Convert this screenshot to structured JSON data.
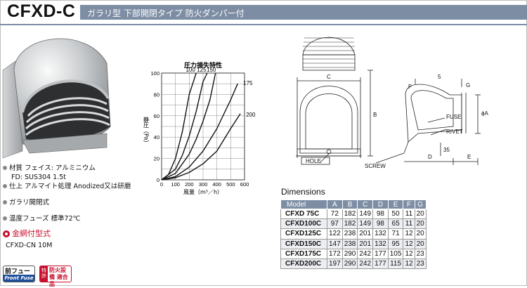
{
  "header": {
    "model": "CFXD-C",
    "tagline": "ガラリ型 下部開閉タイプ 防火ダンパー付"
  },
  "specs": {
    "material_label": "材質 フェイス: アルミニウム",
    "material_fd": "FD: SUS304 1.5t",
    "finish": "仕上 アルマイト処理 Anodized又は研磨",
    "louver": "ガラリ開閉式",
    "fuse": "温度フューズ 標準72℃",
    "mesh_option": "金網付型式",
    "mesh_model": "CFXD-CN 10M"
  },
  "badges": {
    "front_fuse_jp": "前フューズ",
    "front_fuse_en": "Front Fuse",
    "fire_side": "特許",
    "fire_text": "防火設備 適合品"
  },
  "chart_data": {
    "type": "line",
    "title": "圧力損失特性",
    "xlabel": "風量（m³／h）",
    "ylabel": "静圧（Pa）",
    "xlim": [
      0,
      600
    ],
    "ylim": [
      0,
      100
    ],
    "xticks": [
      0,
      100,
      200,
      300,
      400,
      500,
      600
    ],
    "yticks": [
      0,
      10,
      20,
      30,
      40,
      50,
      60,
      70,
      80,
      90,
      100
    ],
    "grid": true,
    "series": [
      {
        "name": "100",
        "x": [
          0,
          50,
          100,
          150,
          200,
          250
        ],
        "y": [
          0,
          5,
          20,
          45,
          80,
          100
        ]
      },
      {
        "name": "125",
        "x": [
          0,
          100,
          150,
          200,
          250,
          300,
          330
        ],
        "y": [
          0,
          10,
          23,
          41,
          64,
          92,
          100
        ]
      },
      {
        "name": "150",
        "x": [
          0,
          100,
          200,
          250,
          300,
          350,
          390
        ],
        "y": [
          0,
          6,
          24,
          38,
          55,
          75,
          100
        ]
      },
      {
        "name": "175",
        "x": [
          0,
          100,
          200,
          300,
          400,
          500,
          550
        ],
        "y": [
          0,
          3,
          12,
          27,
          48,
          75,
          90
        ]
      },
      {
        "name": "200",
        "x": [
          0,
          100,
          200,
          300,
          400,
          500,
          570
        ],
        "y": [
          0,
          2,
          7,
          15,
          27,
          48,
          62
        ]
      }
    ]
  },
  "drawing": {
    "labels": [
      "C",
      "B",
      "HOLE",
      "A",
      "F",
      "5",
      "G",
      "FUSE",
      "RIVET",
      "SCREW",
      "D",
      "E",
      "35"
    ]
  },
  "dimensions": {
    "title": "Dimensions",
    "headers": [
      "Model",
      "A",
      "B",
      "C",
      "D",
      "E",
      "F",
      "G"
    ],
    "rows": [
      [
        "CFXD  75C",
        "72",
        "182",
        "149",
        "98",
        "50",
        "11",
        "20"
      ],
      [
        "CFXD100C",
        "97",
        "182",
        "149",
        "98",
        "65",
        "11",
        "20"
      ],
      [
        "CFXD125C",
        "122",
        "238",
        "201",
        "132",
        "71",
        "12",
        "20"
      ],
      [
        "CFXD150C",
        "147",
        "238",
        "201",
        "132",
        "95",
        "12",
        "20"
      ],
      [
        "CFXD175C",
        "172",
        "290",
        "242",
        "177",
        "105",
        "12",
        "23"
      ],
      [
        "CFXD200C",
        "197",
        "290",
        "242",
        "177",
        "115",
        "12",
        "23"
      ]
    ]
  },
  "colors": {
    "accent_bar": "#7d8da4",
    "accent_red": "#c8102e",
    "badge_blue": "#1d4f9c"
  }
}
